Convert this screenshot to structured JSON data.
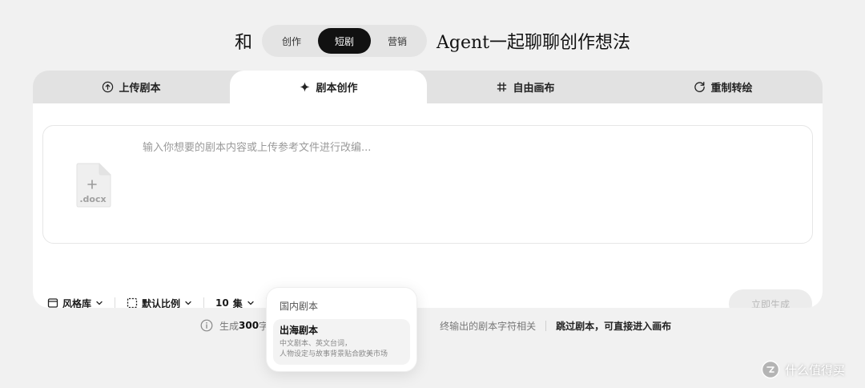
{
  "headline": {
    "prefix": "和",
    "suffix": "Agent一起聊聊创作想法",
    "modes": [
      {
        "label": "创作",
        "active": false
      },
      {
        "label": "短剧",
        "active": true
      },
      {
        "label": "营销",
        "active": false
      }
    ]
  },
  "tabs": [
    {
      "label": "上传剧本",
      "icon": "upload-circle-icon",
      "active": false
    },
    {
      "label": "剧本创作",
      "icon": "sparkle-icon",
      "active": true
    },
    {
      "label": "自由画布",
      "icon": "hash-icon",
      "active": false
    },
    {
      "label": "重制转绘",
      "icon": "refresh-icon",
      "active": false
    }
  ],
  "prompt": {
    "placeholder": "输入你想要的剧本内容或上传参考文件进行改编...",
    "file_icon_label": ".docx"
  },
  "toolbar": {
    "style_library": "风格库",
    "aspect_ratio": "默认比例",
    "episodes_count": "10",
    "episodes_unit": "集",
    "script_type": "出海剧本",
    "generate": "立即生成"
  },
  "footer": {
    "prefix": "生成",
    "count": "300",
    "count_suffix": "字",
    "middle": "终输出的剧本字符相关",
    "skip_link": "跳过剧本，可直接进入画布"
  },
  "dropdown": {
    "options": [
      {
        "title": "国内剧本"
      },
      {
        "title": "出海剧本",
        "desc_line1": "中文剧本、英文台词，",
        "desc_line2": "人物设定与故事背景贴合欧美市场"
      }
    ]
  },
  "watermark": {
    "text": "什么值得买"
  },
  "colors": {
    "background": "#f1f1f1",
    "active_mode": "#111111",
    "card_header": "#e2e2e2",
    "disabled_button": "#ececec"
  }
}
